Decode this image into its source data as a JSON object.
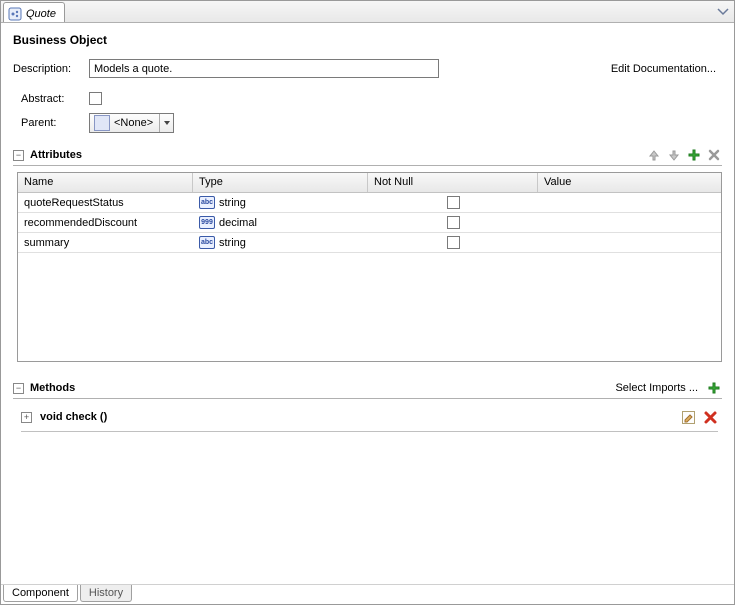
{
  "editor_tab": {
    "title": "Quote"
  },
  "header": {
    "title": "Business Object"
  },
  "form": {
    "description_label": "Description:",
    "description_value": "Models a quote.",
    "edit_doc_label": "Edit Documentation...",
    "abstract_label": "Abstract:",
    "abstract_checked": false,
    "parent_label": "Parent:",
    "parent_value": "<None>"
  },
  "attributes": {
    "section_label": "Attributes",
    "columns": {
      "name": "Name",
      "type": "Type",
      "notnull": "Not Null",
      "value": "Value"
    },
    "rows": [
      {
        "name": "quoteRequestStatus",
        "type": "string",
        "type_icon": "abc",
        "notnull": false,
        "value": ""
      },
      {
        "name": "recommendedDiscount",
        "type": "decimal",
        "type_icon": "999",
        "notnull": false,
        "value": ""
      },
      {
        "name": "summary",
        "type": "string",
        "type_icon": "abc",
        "notnull": false,
        "value": ""
      }
    ]
  },
  "methods": {
    "section_label": "Methods",
    "select_imports_label": "Select Imports ...",
    "items": [
      {
        "signature": "void check ()"
      }
    ]
  },
  "bottom_tabs": {
    "component": "Component",
    "history": "History"
  }
}
